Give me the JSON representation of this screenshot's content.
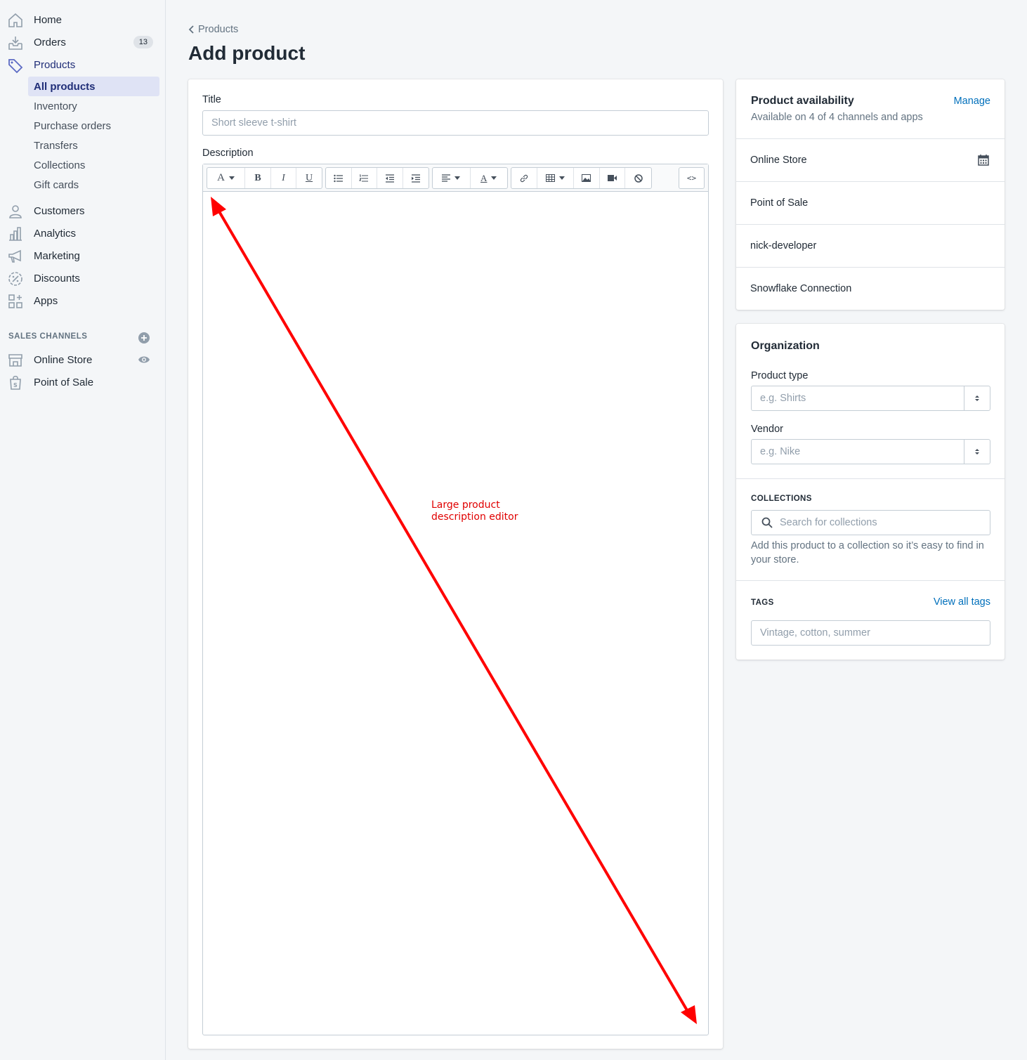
{
  "nav": {
    "home": "Home",
    "orders": "Orders",
    "orders_badge": "13",
    "products": "Products",
    "sub": [
      "All products",
      "Inventory",
      "Purchase orders",
      "Transfers",
      "Collections",
      "Gift cards"
    ],
    "customers": "Customers",
    "analytics": "Analytics",
    "marketing": "Marketing",
    "discounts": "Discounts",
    "apps": "Apps",
    "sales_channels_heading": "SALES CHANNELS",
    "online_store": "Online Store",
    "point_of_sale": "Point of Sale"
  },
  "header": {
    "breadcrumb": "Products",
    "title": "Add product"
  },
  "product": {
    "title_label": "Title",
    "title_placeholder": "Short sleeve t-shirt",
    "description_label": "Description"
  },
  "annotation": {
    "line1": "Large product",
    "line2": "description editor",
    "color": "#e00000"
  },
  "availability": {
    "title": "Product availability",
    "manage": "Manage",
    "subtitle": "Available on 4 of 4 channels and apps",
    "channels": [
      "Online Store",
      "Point of Sale",
      "nick-developer",
      "Snowflake Connection"
    ]
  },
  "organization": {
    "title": "Organization",
    "product_type_label": "Product type",
    "product_type_placeholder": "e.g. Shirts",
    "vendor_label": "Vendor",
    "vendor_placeholder": "e.g. Nike",
    "collections_heading": "COLLECTIONS",
    "collections_placeholder": "Search for collections",
    "collections_help_1": "Add this product to a collection so it’s easy to find in",
    "collections_help_2": "your store.",
    "tags_heading": "TAGS",
    "view_all_tags": "View all tags",
    "tags_placeholder": "Vintage, cotton, summer"
  },
  "colors": {
    "accent": "#5c6ac4",
    "link": "#006fbb",
    "selected_bg": "#dfe3f5"
  }
}
